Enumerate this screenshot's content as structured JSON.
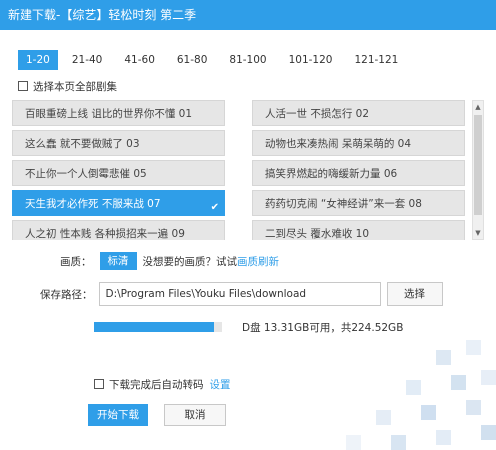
{
  "window": {
    "title": "新建下载-【综艺】轻松时刻 第二季"
  },
  "tabs": [
    {
      "label": "1-20",
      "active": true
    },
    {
      "label": "21-40",
      "active": false
    },
    {
      "label": "41-60",
      "active": false
    },
    {
      "label": "61-80",
      "active": false
    },
    {
      "label": "81-100",
      "active": false
    },
    {
      "label": "101-120",
      "active": false
    },
    {
      "label": "121-121",
      "active": false
    }
  ],
  "select_all_label": "选择本页全部剧集",
  "episodes": [
    {
      "label": "百眼重磅上线 诅比的世界你不懂 01",
      "selected": false
    },
    {
      "label": "人活一世 不损怎行 02",
      "selected": false
    },
    {
      "label": "这么蠢 就不要做贼了 03",
      "selected": false
    },
    {
      "label": "动物也来凑热闹 呆萌呆萌的 04",
      "selected": false
    },
    {
      "label": "不止你一个人倒霉悲催 05",
      "selected": false
    },
    {
      "label": "搞笑界燃起的嗨缓新力量 06",
      "selected": false
    },
    {
      "label": "天生我才必作死 不服来战 07",
      "selected": true
    },
    {
      "label": "药药切克闹 “女神经讲”来一套 08",
      "selected": false
    },
    {
      "label": "人之初 性本贱 各种损招来一遍 09",
      "selected": false
    },
    {
      "label": "二到尽头 覆水难收 10",
      "selected": false
    }
  ],
  "quality": {
    "label": "画质：",
    "selected": "标清",
    "prompt": "没想要的画质？试试",
    "link": "画质刷新"
  },
  "save_path": {
    "label": "保存路径：",
    "value": "D:\\Program Files\\Youku Files\\download",
    "browse_label": "选择"
  },
  "disk": {
    "text": "D盘 13.31GB可用，共224.52GB",
    "used_fraction": 0.94
  },
  "auto_transcode": {
    "label": "下载完成后自动转码",
    "settings_link": "设置",
    "checked": false
  },
  "buttons": {
    "start": "开始下载",
    "cancel": "取消"
  },
  "colors": {
    "accent": "#2f9ee8",
    "item_bg": "#e6e6e6"
  }
}
